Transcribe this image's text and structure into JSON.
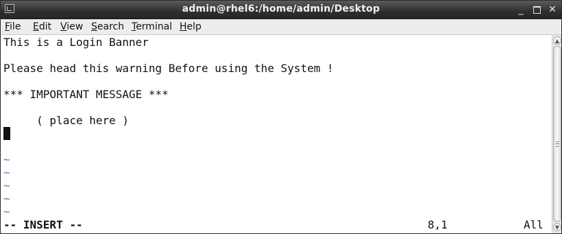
{
  "window": {
    "title": "admin@rhel6:/home/admin/Desktop",
    "icon": "terminal-icon",
    "controls": {
      "minimize": "_",
      "close": "✕"
    }
  },
  "menu": [
    {
      "pre": "",
      "acc": "F",
      "post": "ile"
    },
    {
      "pre": "",
      "acc": "E",
      "post": "dit"
    },
    {
      "pre": "",
      "acc": "V",
      "post": "iew"
    },
    {
      "pre": "",
      "acc": "S",
      "post": "earch"
    },
    {
      "pre": "",
      "acc": "T",
      "post": "erminal"
    },
    {
      "pre": "",
      "acc": "H",
      "post": "elp"
    }
  ],
  "editor": {
    "lines": [
      "This is a Login Banner",
      "",
      "Please head this warning Before using the System !",
      "",
      "*** IMPORTANT MESSAGE ***",
      "",
      "     ( place here )"
    ],
    "empty_marker": "~",
    "empty_marker_count": 5,
    "cursor_line": 8,
    "cursor_col": 1
  },
  "status": {
    "mode": "-- INSERT --",
    "position": "8,1",
    "scroll": "All"
  },
  "colors": {
    "titlebar": "#2f2f2f",
    "tilde": "#4a7fc0",
    "background": "#ffffff"
  }
}
